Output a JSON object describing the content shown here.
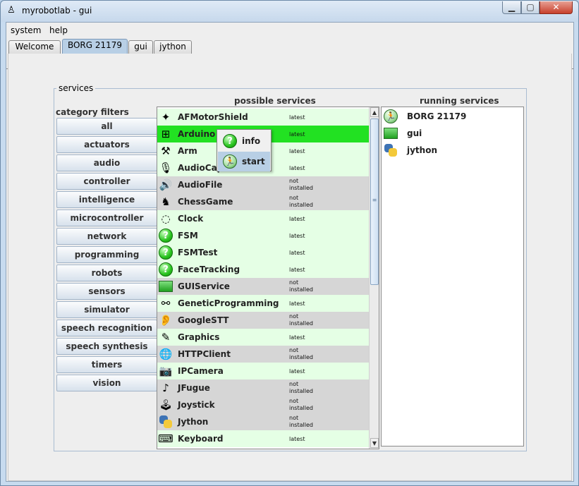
{
  "window": {
    "title": "myrobotlab - gui",
    "app_icon_glyph": "♙",
    "minimize_glyph": "▁",
    "maximize_glyph": "▢",
    "close_glyph": "✕"
  },
  "menubar": {
    "items": [
      "system",
      "help"
    ]
  },
  "tabs": [
    {
      "label": "Welcome",
      "selected": false
    },
    {
      "label": "BORG 21179",
      "selected": true
    },
    {
      "label": "gui",
      "selected": false
    },
    {
      "label": "jython",
      "selected": false
    }
  ],
  "services_panel": {
    "group_label": "services",
    "category_filters_label": "category filters",
    "possible_services_label": "possible services",
    "running_services_label": "running services"
  },
  "category_filters": [
    "all",
    "actuators",
    "audio",
    "controller",
    "intelligence",
    "microcontroller",
    "network",
    "programming",
    "robots",
    "sensors",
    "simulator",
    "speech recognition",
    "speech synthesis",
    "timers",
    "vision"
  ],
  "possible_services": [
    {
      "name": "AFMotorShield",
      "status": "latest",
      "icon": "star-icon",
      "glyph": "✦",
      "selected": false
    },
    {
      "name": "Arduino",
      "status": "latest",
      "icon": "arduino-icon",
      "glyph": "⊞",
      "selected": true
    },
    {
      "name": "Arm",
      "status": "latest",
      "icon": "robot-arm-icon",
      "glyph": "⚒",
      "selected": false
    },
    {
      "name": "AudioCapture",
      "status": "latest",
      "icon": "microphone-icon",
      "glyph": "🎙",
      "selected": false
    },
    {
      "name": "AudioFile",
      "status": "not installed",
      "icon": "speaker-icon",
      "glyph": "🔊",
      "selected": false
    },
    {
      "name": "ChessGame",
      "status": "not installed",
      "icon": "chess-icon",
      "glyph": "♞",
      "selected": false
    },
    {
      "name": "Clock",
      "status": "latest",
      "icon": "clock-icon",
      "glyph": "◌",
      "selected": false
    },
    {
      "name": "FSM",
      "status": "latest",
      "icon": "question-icon",
      "glyph": "?",
      "selected": false
    },
    {
      "name": "FSMTest",
      "status": "latest",
      "icon": "question-icon",
      "glyph": "?",
      "selected": false
    },
    {
      "name": "FaceTracking",
      "status": "latest",
      "icon": "question-icon",
      "glyph": "?",
      "selected": false
    },
    {
      "name": "GUIService",
      "status": "not installed",
      "icon": "monitor-icon",
      "glyph": "▭",
      "selected": false
    },
    {
      "name": "GeneticProgramming",
      "status": "latest",
      "icon": "dna-icon",
      "glyph": "⚯",
      "selected": false
    },
    {
      "name": "GoogleSTT",
      "status": "not installed",
      "icon": "ear-icon",
      "glyph": "👂",
      "selected": false
    },
    {
      "name": "Graphics",
      "status": "latest",
      "icon": "graphics-icon",
      "glyph": "✎",
      "selected": false
    },
    {
      "name": "HTTPClient",
      "status": "not installed",
      "icon": "globe-icon",
      "glyph": "🌐",
      "selected": false
    },
    {
      "name": "IPCamera",
      "status": "latest",
      "icon": "camera-icon",
      "glyph": "📷",
      "selected": false
    },
    {
      "name": "JFugue",
      "status": "not installed",
      "icon": "music-note-icon",
      "glyph": "♪",
      "selected": false
    },
    {
      "name": "Joystick",
      "status": "not installed",
      "icon": "joystick-icon",
      "glyph": "🕹",
      "selected": false
    },
    {
      "name": "Jython",
      "status": "not installed",
      "icon": "python-icon",
      "glyph": "",
      "selected": false
    },
    {
      "name": "Keyboard",
      "status": "latest",
      "icon": "keyboard-icon",
      "glyph": "⌨",
      "selected": false
    }
  ],
  "context_menu": {
    "items": [
      {
        "label": "info",
        "icon": "question-icon",
        "glyph": "?"
      },
      {
        "label": "start",
        "icon": "running-man-icon",
        "glyph": "🏃"
      }
    ]
  },
  "scrollbar": {
    "up_glyph": "▲",
    "down_glyph": "▼",
    "grip_glyph": "≡"
  },
  "running_services": [
    {
      "name": "BORG 21179",
      "icon": "running-man-icon",
      "glyph": "🏃"
    },
    {
      "name": "gui",
      "icon": "monitor-icon",
      "glyph": ""
    },
    {
      "name": "jython",
      "icon": "python-icon",
      "glyph": ""
    }
  ]
}
